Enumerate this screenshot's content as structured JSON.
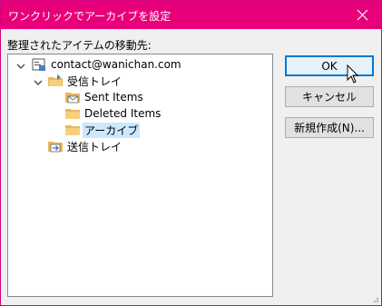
{
  "window": {
    "title": "ワンクリックでアーカイブを設定",
    "accent_color": "#e8007a"
  },
  "prompt_label": "整理されたアイテムの移動先:",
  "tree": {
    "account": "contact@wanichan.com",
    "inbox": "受信トレイ",
    "inbox_children": [
      "Sent Items",
      "Deleted Items",
      "アーカイブ"
    ],
    "outbox": "送信トレイ",
    "selected": "アーカイブ"
  },
  "buttons": {
    "ok": "OK",
    "cancel": "キャンセル",
    "new": "新規作成(N)..."
  }
}
